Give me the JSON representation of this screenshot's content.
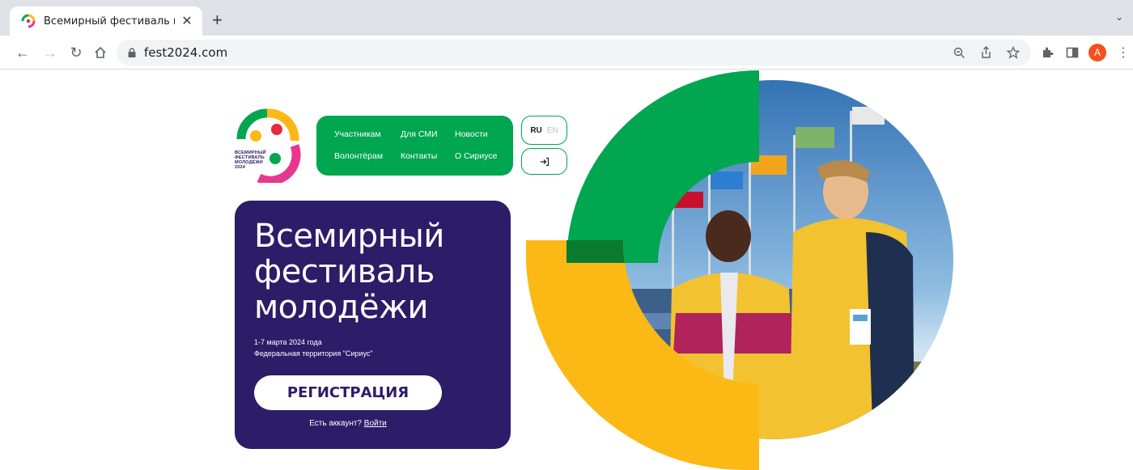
{
  "browser": {
    "tab_title": "Всемирный фестиваль молод",
    "tab_close": "✕",
    "new_tab": "+",
    "tab_menu": "⌄",
    "url": "fest2024.com",
    "avatar_letter": "A"
  },
  "logo": {
    "lines": [
      "ВСЕМИРНЫЙ",
      "ФЕСТИВАЛЬ",
      "МОЛОДЁЖИ",
      "2024"
    ]
  },
  "nav": {
    "participants": "Участникам",
    "media": "Для СМИ",
    "news": "Новости",
    "volunteers": "Волонтёрам",
    "contacts": "Контакты",
    "about": "О Сириусе"
  },
  "lang": {
    "ru": "RU",
    "en": "EN"
  },
  "hero": {
    "title_lines": [
      "Всемирный",
      "фестиваль",
      "молодёжи"
    ],
    "date": "1-7 марта 2024 года",
    "place": "Федеральная территория \"Сириус\"",
    "register": "РЕГИСТРАЦИЯ",
    "has_account": "Есть аккаунт?",
    "login": "Войти"
  },
  "colors": {
    "green": "#00a650",
    "purple": "#2d1c68",
    "yellow": "#fcb814",
    "pink": "#e8378f",
    "red": "#e42c3b"
  }
}
